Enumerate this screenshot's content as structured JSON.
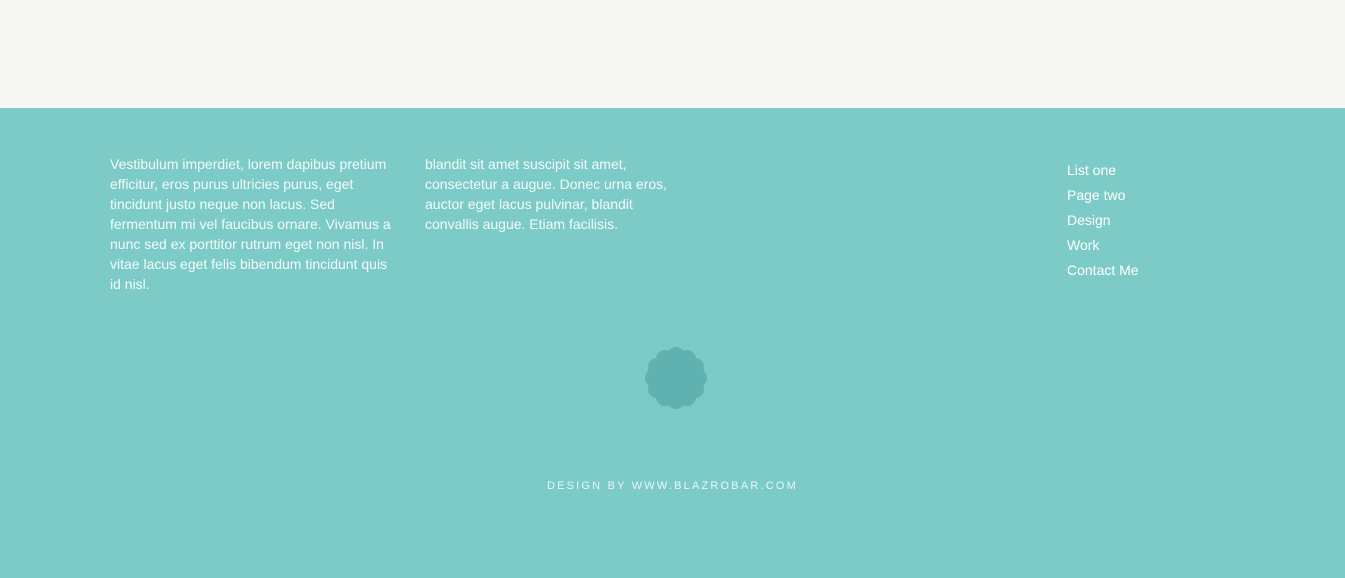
{
  "colors": {
    "top_band": "#f6f6f4",
    "footer_bg": "#7ccbc7",
    "emblem_fill": "#5fb2b0",
    "text": "#ffffff"
  },
  "footer": {
    "paragraph_one": "Vestibulum imperdiet, lorem dapibus pretium efficitur, eros purus ultricies purus, eget tincidunt justo neque non lacus. Sed fermentum mi vel faucibus ornare. Vivamus a nunc sed ex porttitor rutrum eget non nisl. In vitae lacus eget felis bibendum tincidunt quis id nisl.",
    "paragraph_two": "blandit sit amet suscipit sit amet, consectetur a augue. Donec urna eros, auctor eget lacus pulvinar, blandit convallis augue. Etiam facilisis.",
    "nav": {
      "items": [
        {
          "label": "List one"
        },
        {
          "label": "Page two"
        },
        {
          "label": "Design"
        },
        {
          "label": "Work"
        },
        {
          "label": "Contact Me"
        }
      ]
    },
    "emblem_icon": "scalloped-badge-icon",
    "credit_prefix": "DESIGN BY ",
    "credit_link": "WWW.BLAZROBAR.COM"
  }
}
